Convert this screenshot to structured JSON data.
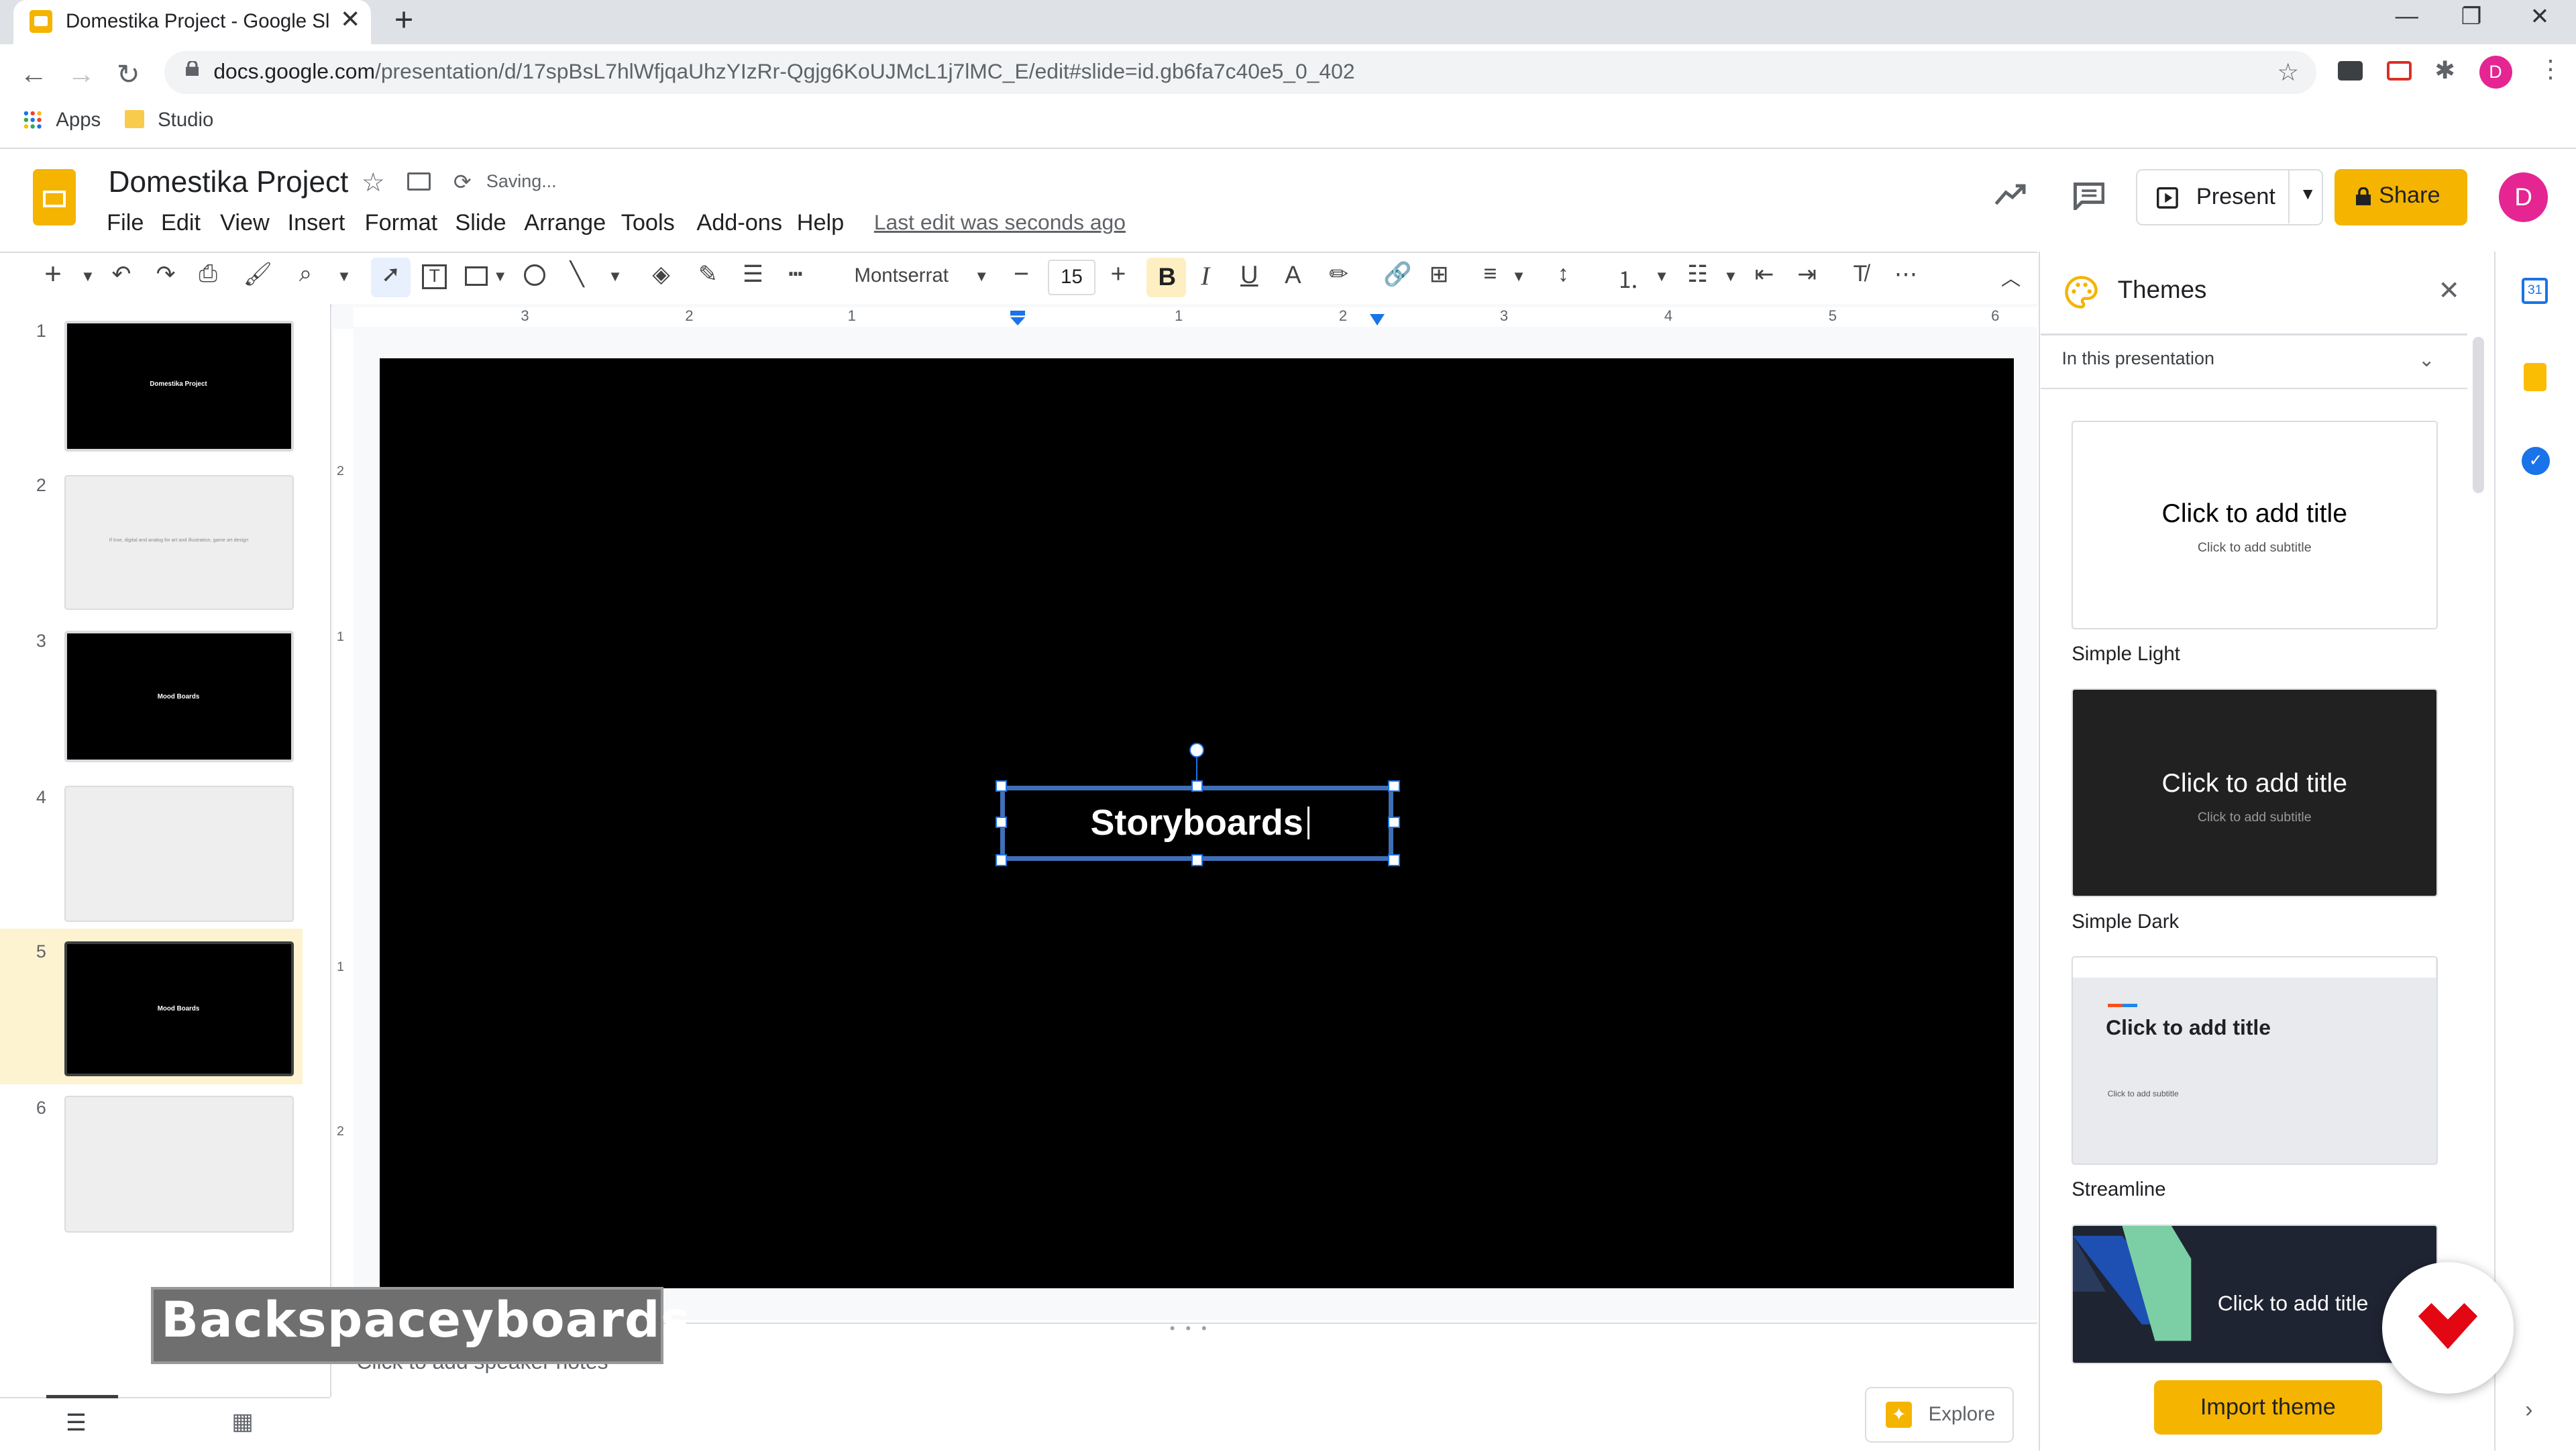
{
  "browser": {
    "tab_title": "Domestika Project - Google Slides",
    "url_host": "docs.google.com",
    "url_path": "/presentation/d/17spBsL7hlWfjqaUhzYIzRr-Qgjg6KoUJMcL1j7lMC_E/edit#slide=id.gb6fa7c40e5_0_402",
    "bookmarks": [
      "Apps",
      "Studio"
    ],
    "profile_initial": "D"
  },
  "header": {
    "doc_title": "Domestika Project",
    "save_status": "Saving...",
    "menu": [
      "File",
      "Edit",
      "View",
      "Insert",
      "Format",
      "Slide",
      "Arrange",
      "Tools",
      "Add-ons",
      "Help"
    ],
    "last_edit": "Last edit was seconds ago",
    "present_label": "Present",
    "share_label": "Share",
    "avatar_initial": "D"
  },
  "toolbar": {
    "font_name": "Montserrat",
    "font_size": "15"
  },
  "filmstrip": {
    "slides": [
      {
        "num": "1",
        "text": "Domestika Project",
        "bg": "#000000"
      },
      {
        "num": "2",
        "text": "If true, digital and analog for art and illustration, game art design",
        "bg": "#eeeeee"
      },
      {
        "num": "3",
        "text": "Mood Boards",
        "bg": "#000000"
      },
      {
        "num": "4",
        "text": "",
        "bg": "#eeeeee"
      },
      {
        "num": "5",
        "text": "Mood Boards",
        "bg": "#000000"
      },
      {
        "num": "6",
        "text": "",
        "bg": "#eeeeee"
      }
    ],
    "selected": "5"
  },
  "ruler": {
    "h_ticks": [
      "3",
      "2",
      "1",
      "1",
      "2",
      "3",
      "4",
      "5",
      "6"
    ],
    "v_ticks": [
      "2",
      "1",
      "1",
      "2"
    ]
  },
  "slide": {
    "text": "Storyboards"
  },
  "notes": {
    "placeholder": "Click to add speaker notes",
    "explore_label": "Explore"
  },
  "themes": {
    "title": "Themes",
    "section": "In this presentation",
    "items": [
      {
        "name": "Simple Light",
        "title": "Click to add title",
        "subtitle": "Click to add subtitle"
      },
      {
        "name": "Simple Dark",
        "title": "Click to add title",
        "subtitle": "Click to add subtitle"
      },
      {
        "name": "Streamline",
        "title": "Click to add title",
        "subtitle": "Click to add subtitle"
      },
      {
        "name": "",
        "title": "Click to add title",
        "subtitle": ""
      }
    ],
    "import_label": "Import theme"
  },
  "overlay": {
    "caption": "Backspaceyboards"
  },
  "colors": {
    "accent": "#f4b400",
    "selection": "#3f6fb6",
    "avatar": "#e52592"
  }
}
